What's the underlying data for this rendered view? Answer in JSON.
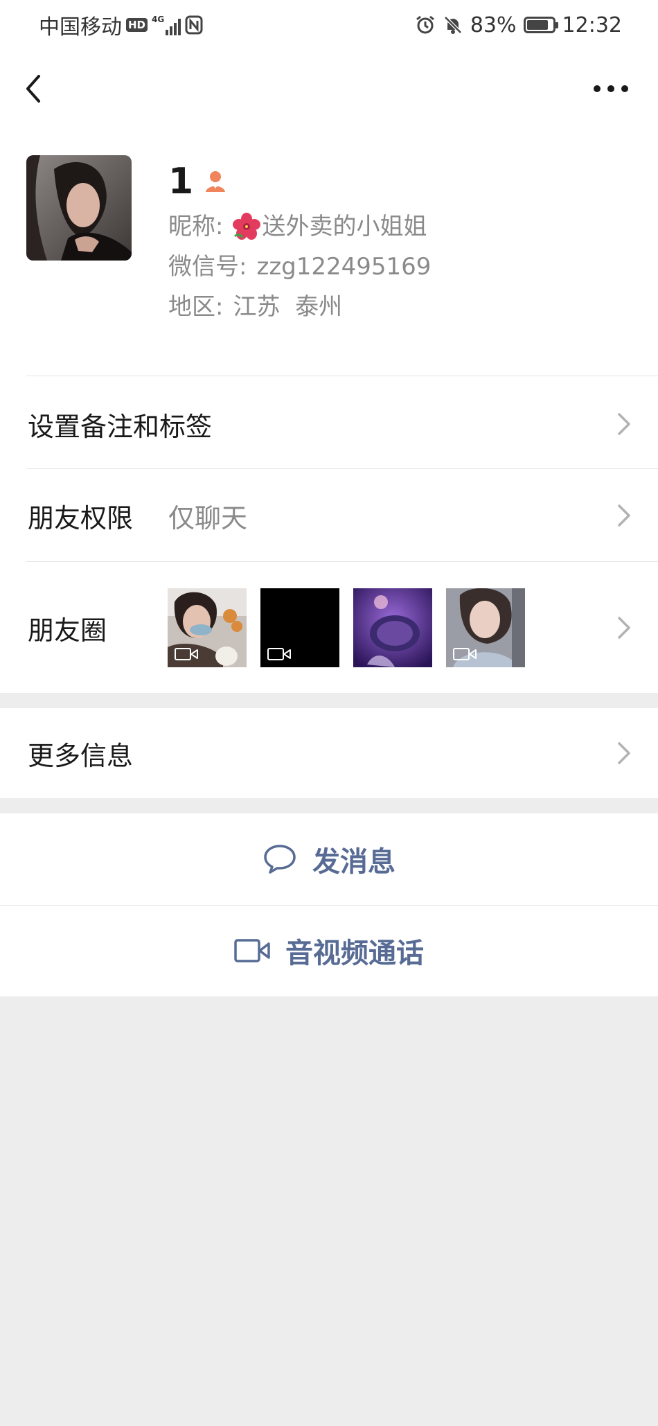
{
  "status_bar": {
    "carrier": "中国移动",
    "hd": "HD",
    "network": "4G",
    "battery_percent_text": "83%",
    "battery_level": 0.83,
    "time": "12:32"
  },
  "profile": {
    "display_name": "1",
    "nickname_label": "昵称:",
    "nickname": "送外卖的小姐姐",
    "wechat_id_label": "微信号:",
    "wechat_id": "zzg122495169",
    "region_label": "地区:",
    "region": "江苏  泰州",
    "gender_icon_color": "#f0845a"
  },
  "menu": {
    "remark_tags": "设置备注和标签",
    "permission_label": "朋友权限",
    "permission_value": "仅聊天",
    "moments_label": "朋友圈",
    "more_info": "更多信息"
  },
  "moments": [
    {
      "type": "video",
      "tone": "#b7a08e"
    },
    {
      "type": "video",
      "tone": "#000000"
    },
    {
      "type": "image",
      "tone": "#5a2fa0"
    },
    {
      "type": "video",
      "tone": "#8c8e96"
    }
  ],
  "actions": {
    "send_message": "发消息",
    "video_call": "音视频通话"
  },
  "colors": {
    "link_blue": "#576b95",
    "background": "#ededed",
    "secondary_text": "#8a8a8a"
  }
}
